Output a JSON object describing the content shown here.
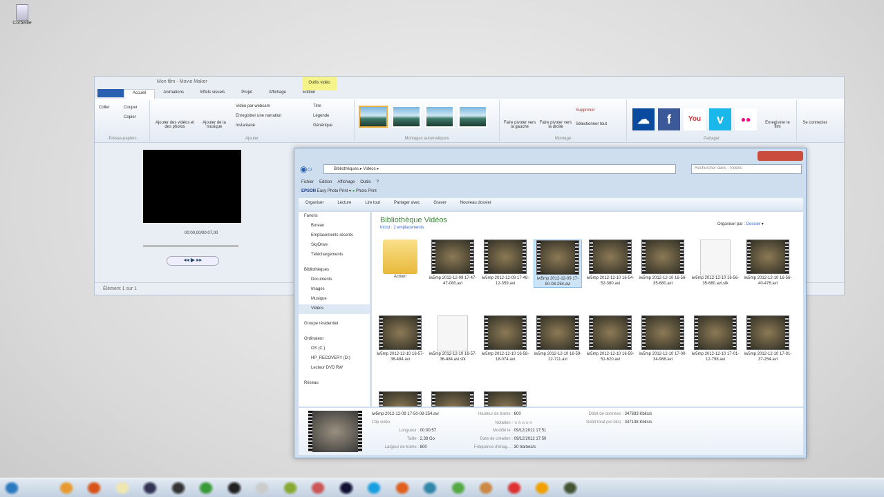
{
  "desktop": {
    "recycle_bin": "Corbeille"
  },
  "movie_maker": {
    "title": "Mon film - Movie Maker",
    "context_tab": "Outils vidéo",
    "tabs": [
      "Accueil",
      "Animations",
      "Effets visuels",
      "Projet",
      "Affichage",
      "Edition"
    ],
    "groups": {
      "clipboard": "Presse-papiers",
      "add": "Ajouter",
      "auto": "Montages automatiques",
      "edit": "Montage",
      "share": "Partager"
    },
    "buttons": {
      "paste": "Coller",
      "cut": "Couper",
      "copy": "Copier",
      "add_videos": "Ajouter des vidéos et des photos",
      "add_music": "Ajouter de la musique",
      "webcam": "Vidéo par webcam",
      "narration": "Enregistrer une narration",
      "snapshot": "Instantané",
      "title": "Titre",
      "caption": "Légende",
      "credits": "Générique",
      "rotate_left": "Faire pivoter vers la gauche",
      "rotate_right": "Faire pivoter vers la droite",
      "delete": "Supprimer",
      "select_all": "Sélectionner tout",
      "save_movie": "Enregistrer le film",
      "sign_in": "Se connecter"
    },
    "share_icons": [
      "skydrive-icon",
      "facebook-icon",
      "youtube-icon",
      "vimeo-icon",
      "flickr-icon"
    ],
    "time": "00:00,00/00:07,00",
    "status": "Élément 1 sur 1"
  },
  "explorer": {
    "breadcrumb": [
      "Bibliothèques",
      "Vidéos"
    ],
    "search_placeholder": "Rechercher dans : Vidéos",
    "menu": [
      "Fichier",
      "Edition",
      "Affichage",
      "Outils",
      "?"
    ],
    "epson": "EPSON",
    "epson_items": [
      "Easy Photo Print",
      "Photo Print"
    ],
    "commands": [
      "Organiser",
      "Lecture",
      "Lire tout",
      "Partager avec",
      "Graver",
      "Nouveau dossier"
    ],
    "nav": [
      "Favoris",
      "Bureau",
      "Emplacements récents",
      "SkyDrive",
      "Téléchargements",
      "",
      "Bibliothèques",
      "Documents",
      "Images",
      "Musique",
      "Vidéos",
      "",
      "Groupe résidentiel",
      "",
      "Ordinateur",
      "OS (C:)",
      "HP_RECOVERY (D:)",
      "Lecteur DVD RW",
      "",
      "Réseau"
    ],
    "library_title": "Bibliothèque Vidéos",
    "library_sub": "Inclut : 2 emplacements",
    "arrange_label": "Organiser par :",
    "arrange_value": "Dossier",
    "items": [
      {
        "type": "folder",
        "name": "Action!"
      },
      {
        "type": "video",
        "name": "iw5mp 2012-12-09 17-47-47-080.avi"
      },
      {
        "type": "video",
        "name": "iw5mp 2012-12-09 17-48-12-359.avi"
      },
      {
        "type": "video",
        "name": "iw5mp 2012-12-09 17-50-08-254.avi",
        "selected": true
      },
      {
        "type": "video",
        "name": "iw5mp 2012-12-10 16-54-52-380.avi"
      },
      {
        "type": "video",
        "name": "iw5mp 2012-12-10 16-56-35-680.avi"
      },
      {
        "type": "file",
        "name": "iw5mp 2012-12-10 16-56-35-680.avi.sfk"
      },
      {
        "type": "video",
        "name": "iw5mp 2012-12-10 16-56-40-476.avi"
      },
      {
        "type": "video",
        "name": "iw5mp 2012-12-10 16-57-36-484.avi"
      },
      {
        "type": "file",
        "name": "iw5mp 2012-12-10 16-57-36-484.avi.sfk"
      },
      {
        "type": "video",
        "name": "iw5mp 2012-12-10 16-58-18-074.avi"
      },
      {
        "type": "video",
        "name": "iw5mp 2012-12-10 16-59-22-711.avi"
      },
      {
        "type": "video",
        "name": "iw5mp 2012-12-10 16-59-51-620.avi"
      },
      {
        "type": "video",
        "name": "iw5mp 2012-12-10 17-00-34-988.avi"
      },
      {
        "type": "video",
        "name": "iw5mp 2012-12-10 17-01-12-798.avi"
      },
      {
        "type": "video",
        "name": "iw5mp 2012-12-10 17-01-37-254.avi"
      },
      {
        "type": "video",
        "name": ""
      },
      {
        "type": "video",
        "name": ""
      },
      {
        "type": "video",
        "name": ""
      }
    ],
    "details": {
      "name": "iw5mp 2012-12-09 17-50-08-254.avi",
      "kind": "Clip vidéo",
      "fields": [
        [
          "Longueur :",
          "00:00:57"
        ],
        [
          "Taille :",
          "2,38 Go"
        ],
        [
          "Largeur de trame :",
          "800"
        ],
        [
          "Hauteur de trame :",
          "600"
        ],
        [
          "Notation :",
          "☆☆☆☆☆"
        ],
        [
          "Modifié le :",
          "09/12/2012 17:51"
        ],
        [
          "Date de création :",
          "09/12/2012 17:50"
        ],
        [
          "Fréquence d'imag... :",
          "30 trames/s"
        ],
        [
          "Débit de données :",
          "347693 Kbits/s"
        ],
        [
          "Débit total (en bits) :",
          "347138 Kbits/s"
        ]
      ]
    }
  },
  "taskbar": {
    "apps": [
      "start",
      "media-player",
      "firefox",
      "explorer",
      "browser",
      "steam",
      "chrome",
      "game",
      "notepad",
      "app",
      "pen",
      "cmd",
      "skype",
      "app2",
      "app3",
      "minecraft",
      "app4",
      "app5",
      "vlc",
      "app6"
    ]
  }
}
